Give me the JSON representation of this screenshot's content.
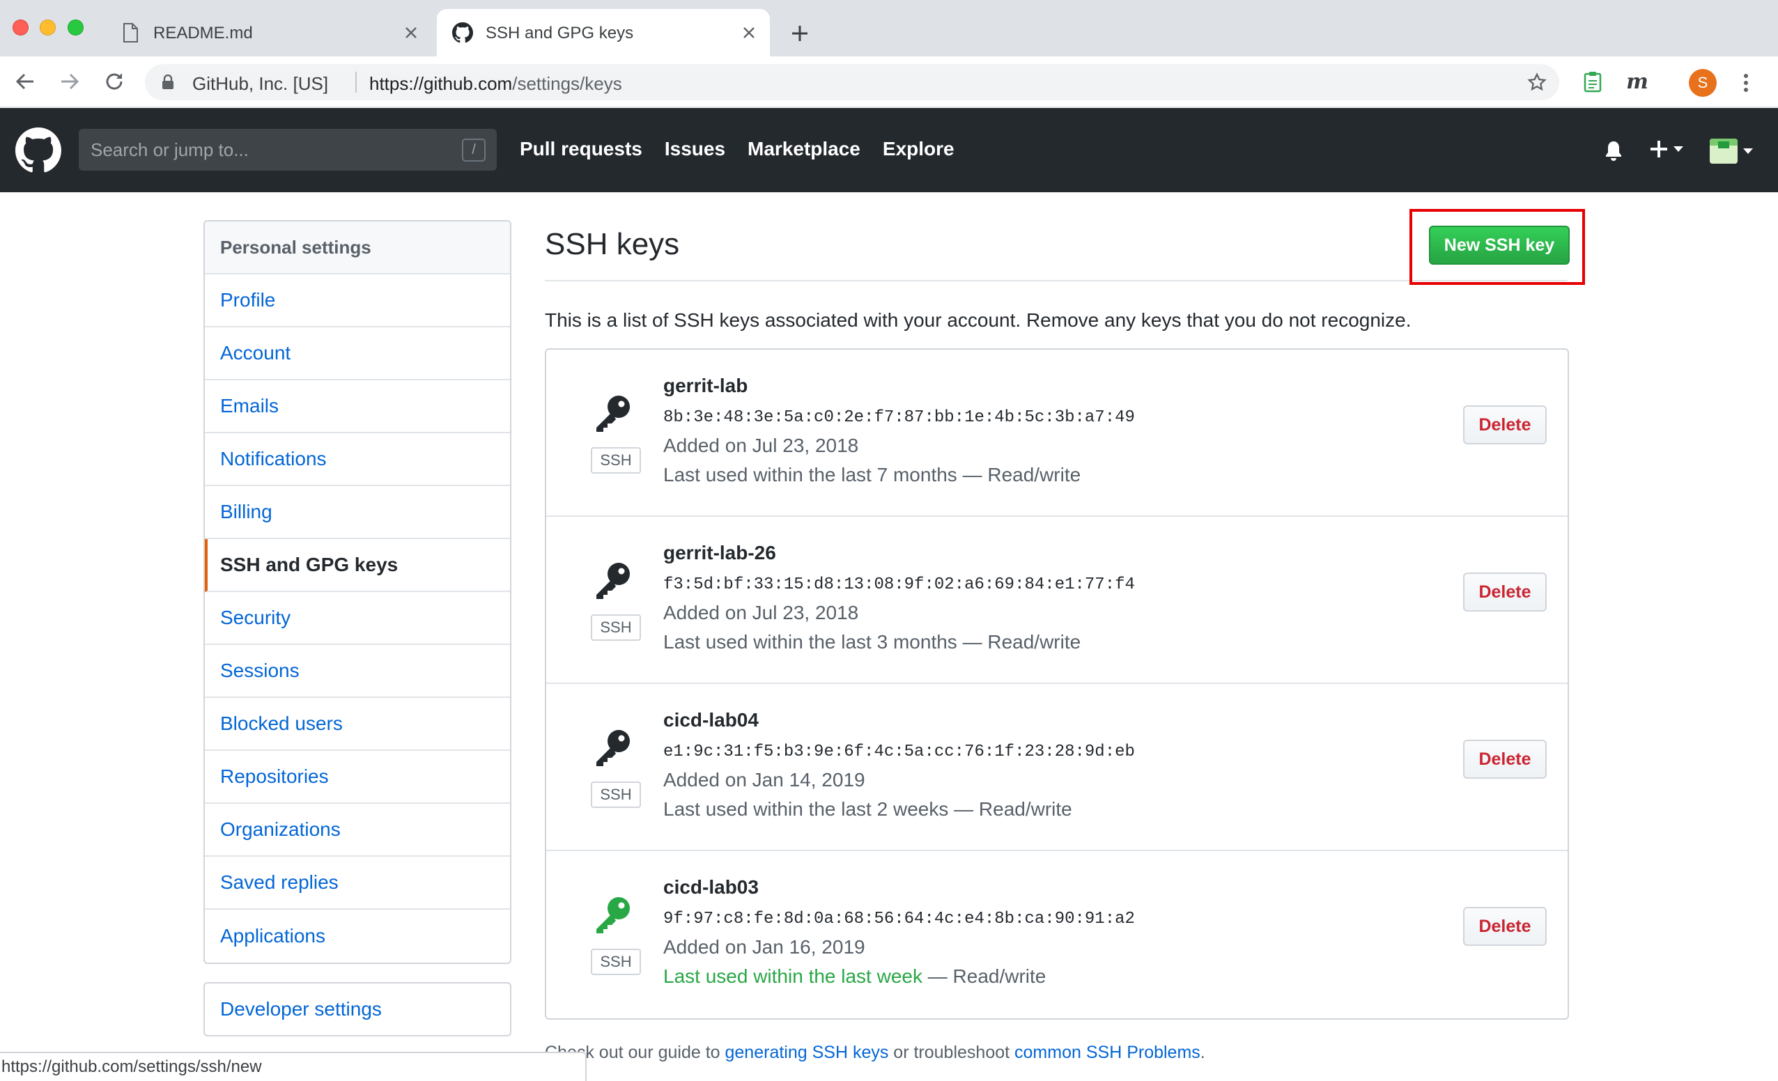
{
  "browser": {
    "tabs": [
      {
        "title": "README.md",
        "active": false,
        "icon": "file-icon"
      },
      {
        "title": "SSH and GPG keys",
        "active": true,
        "icon": "github-icon"
      }
    ],
    "address": {
      "org": "GitHub, Inc. [US]",
      "url_host": "https://github.com",
      "url_path": "/settings/keys"
    },
    "profile_initial": "S",
    "extension_m_label": "m",
    "status_url": "https://github.com/settings/ssh/new"
  },
  "header": {
    "search_placeholder": "Search or jump to...",
    "search_shortcut": "/",
    "nav": [
      "Pull requests",
      "Issues",
      "Marketplace",
      "Explore"
    ]
  },
  "sidebar": {
    "heading": "Personal settings",
    "items": [
      "Profile",
      "Account",
      "Emails",
      "Notifications",
      "Billing",
      "SSH and GPG keys",
      "Security",
      "Sessions",
      "Blocked users",
      "Repositories",
      "Organizations",
      "Saved replies",
      "Applications"
    ],
    "selected": "SSH and GPG keys",
    "developer_settings": "Developer settings"
  },
  "main": {
    "title": "SSH keys",
    "new_key_button": "New SSH key",
    "intro": "This is a list of SSH keys associated with your account. Remove any keys that you do not recognize.",
    "type_label": "SSH",
    "delete_label": "Delete",
    "keys": [
      {
        "name": "gerrit-lab",
        "fingerprint": "8b:3e:48:3e:5a:c0:2e:f7:87:bb:1e:4b:5c:3b:a7:49",
        "added": "Added on Jul 23, 2018",
        "last_used": "Last used within the last 7 months",
        "access": " — Read/write",
        "recent": false
      },
      {
        "name": "gerrit-lab-26",
        "fingerprint": "f3:5d:bf:33:15:d8:13:08:9f:02:a6:69:84:e1:77:f4",
        "added": "Added on Jul 23, 2018",
        "last_used": "Last used within the last 3 months",
        "access": " — Read/write",
        "recent": false
      },
      {
        "name": "cicd-lab04",
        "fingerprint": "e1:9c:31:f5:b3:9e:6f:4c:5a:cc:76:1f:23:28:9d:eb",
        "added": "Added on Jan 14, 2019",
        "last_used": "Last used within the last 2 weeks",
        "access": " — Read/write",
        "recent": false
      },
      {
        "name": "cicd-lab03",
        "fingerprint": "9f:97:c8:fe:8d:0a:68:56:64:4c:e4:8b:ca:90:91:a2",
        "added": "Added on Jan 16, 2019",
        "last_used": "Last used within the last week",
        "access": " — Read/write",
        "recent": true
      }
    ],
    "footer": {
      "prefix": "Check out our guide to ",
      "link1": "generating SSH keys",
      "middle": " or troubleshoot ",
      "link2": "common SSH Problems",
      "suffix": "."
    }
  },
  "colors": {
    "header_bg": "#24292e",
    "link": "#0366d6",
    "primary_button": "#28a745",
    "danger": "#cb2431",
    "selected_accent": "#e36209",
    "highlight_box": "#e60000"
  }
}
